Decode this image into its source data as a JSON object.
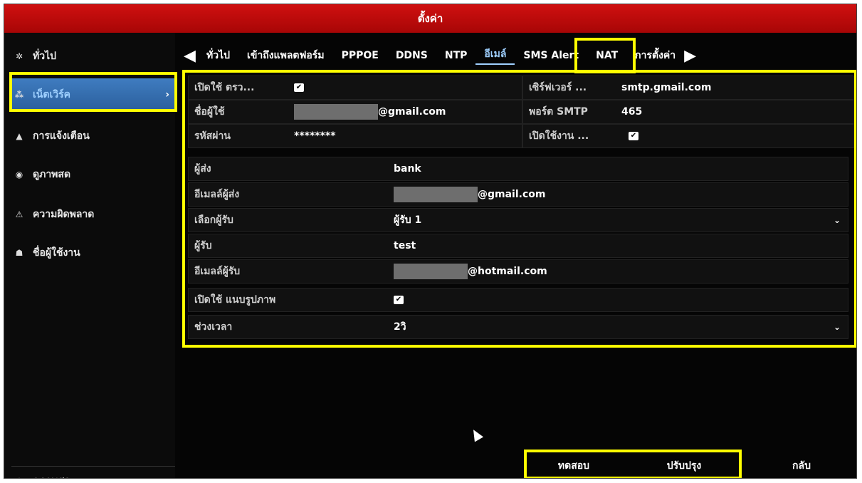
{
  "window": {
    "title": "ตั้งค่า"
  },
  "sidebar": {
    "items": [
      {
        "label": "ทั่วไป",
        "icon": "gear-icon",
        "active": false
      },
      {
        "label": "เน็ตเวิร์ค",
        "icon": "network-icon",
        "active": true
      },
      {
        "label": "การแจ้งเตือน",
        "icon": "alarm-icon",
        "active": false
      },
      {
        "label": "ดูภาพสด",
        "icon": "eye-icon",
        "active": false
      },
      {
        "label": "ความผิดพลาด",
        "icon": "warning-icon",
        "active": false
      },
      {
        "label": "ชื่อผู้ใช้งาน",
        "icon": "users-icon",
        "active": false
      }
    ],
    "bottom": {
      "label": "ดูภาพสด",
      "icon": "home-icon"
    }
  },
  "tabs": {
    "items": [
      "ทั่วไป",
      "เข้าถึงแพลตฟอร์ม",
      "PPPOE",
      "DDNS",
      "NTP",
      "อีเมล์",
      "SMS Alert",
      "NAT",
      "การตั้งค่า"
    ],
    "active": "อีเมล์"
  },
  "server": {
    "enable_label": "เปิดใช้ ตรว...",
    "username_label": "ชื่อผู้ใช้",
    "username_suffix": "@gmail.com",
    "password_label": "รหัสผ่าน",
    "password_value": "********",
    "smtp_server_label": "เซิร์ฟเวอร์ ...",
    "smtp_server_value": "smtp.gmail.com",
    "smtp_port_label": "พอร์ต SMTP",
    "smtp_port_value": "465",
    "enable_ssl_label": "เปิดใช้งาน ..."
  },
  "email": {
    "sender_label": "ผู้ส่ง",
    "sender_value": "bank",
    "sender_email_label": "อีเมลล์ผู้ส่ง",
    "sender_email_suffix": "@gmail.com",
    "select_recipient_label": "เลือกผู้รับ",
    "select_recipient_value": "ผู้รับ 1",
    "recipient_label": "ผู้รับ",
    "recipient_value": "test",
    "recipient_email_label": "อีเมลล์ผู้รับ",
    "recipient_email_suffix": "@hotmail.com",
    "attach_label": "เปิดใช้ แนบรูปภาพ",
    "interval_label": "ช่วงเวลา",
    "interval_value": "2วิ"
  },
  "footer": {
    "test": "ทดสอบ",
    "apply": "ปรับปรุง",
    "back": "กลับ"
  },
  "colors": {
    "title_red": "#c80a0a",
    "highlight": "#ffff00",
    "active_blue": "#3f7cc0"
  }
}
